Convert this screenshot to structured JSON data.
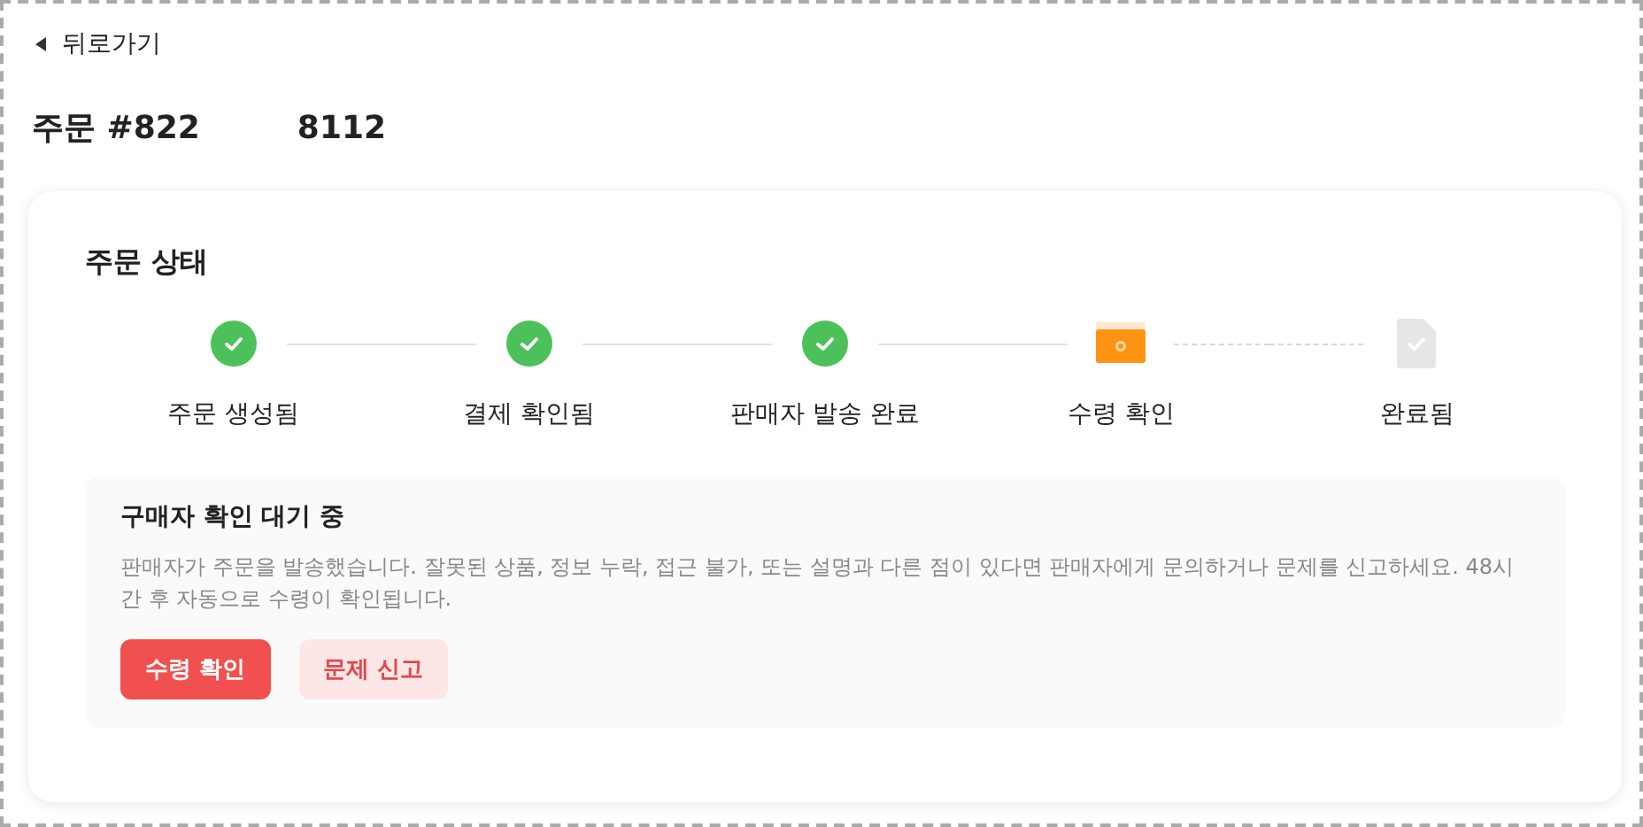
{
  "back_link": {
    "label": "뒤로가기"
  },
  "order_title": {
    "prefix": "주문 #822",
    "suffix": "8112"
  },
  "status_card": {
    "title": "주문 상태",
    "steps": [
      {
        "label": "주문 생성됨",
        "kind": "done"
      },
      {
        "label": "결제 확인됨",
        "kind": "done"
      },
      {
        "label": "판매자 발송 완료",
        "kind": "done"
      },
      {
        "label": "수령 확인",
        "kind": "current"
      },
      {
        "label": "완료됨",
        "kind": "pending"
      }
    ],
    "notice": {
      "title": "구매자 확인 대기 중",
      "text": "판매자가 주문을 발송했습니다. 잘못된 상품, 정보 누락, 접근 불가, 또는 설명과 다른 점이 있다면 판매자에게 문의하거나 문제를 신고하세요. 48시간 후 자동으로 수령이 확인됩니다.",
      "buttons": [
        {
          "label": "수령 확인",
          "kind": "primary"
        },
        {
          "label": "문제 신고",
          "kind": "secondary"
        }
      ]
    }
  }
}
